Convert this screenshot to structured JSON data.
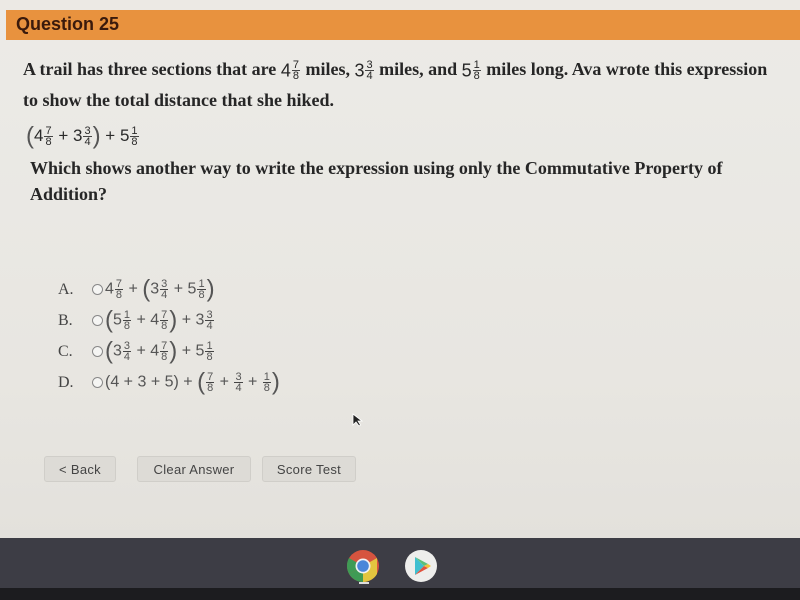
{
  "header": {
    "title": "Question 25"
  },
  "question": {
    "stem_parts": [
      "A trail has three sections that are ",
      " miles, ",
      " miles, and ",
      " miles long. Ava wrote this expression to show the total distance that she hiked."
    ],
    "distances": [
      {
        "whole": "4",
        "num": "7",
        "den": "8"
      },
      {
        "whole": "3",
        "num": "3",
        "den": "4"
      },
      {
        "whole": "5",
        "num": "1",
        "den": "8"
      }
    ],
    "expression": "(4 7/8 + 3 3/4) + 5 1/8",
    "prompt": "Which shows another way to write the expression using only the Commutative Property of Addition?"
  },
  "choices": [
    {
      "letter": "A.",
      "expression": "4 7/8 + (3 3/4 + 5 1/8)",
      "selected": false
    },
    {
      "letter": "B.",
      "expression": "(5 1/8 + 4 7/8) + 3 3/4",
      "selected": false
    },
    {
      "letter": "C.",
      "expression": "(3 3/4 + 4 7/8) + 5 1/8",
      "selected": false
    },
    {
      "letter": "D.",
      "expression": "(4 + 3 + 5) + (7/8 + 3/4 + 1/8)",
      "selected": false
    }
  ],
  "buttons": {
    "back": "< Back",
    "clear": "Clear Answer",
    "score": "Score Test"
  },
  "shelf": {
    "apps": [
      "chrome-icon",
      "play-store-icon"
    ]
  },
  "colors": {
    "header": "#e8923e",
    "header_text": "#3a1a0c",
    "shelf": "#3d3d45"
  }
}
